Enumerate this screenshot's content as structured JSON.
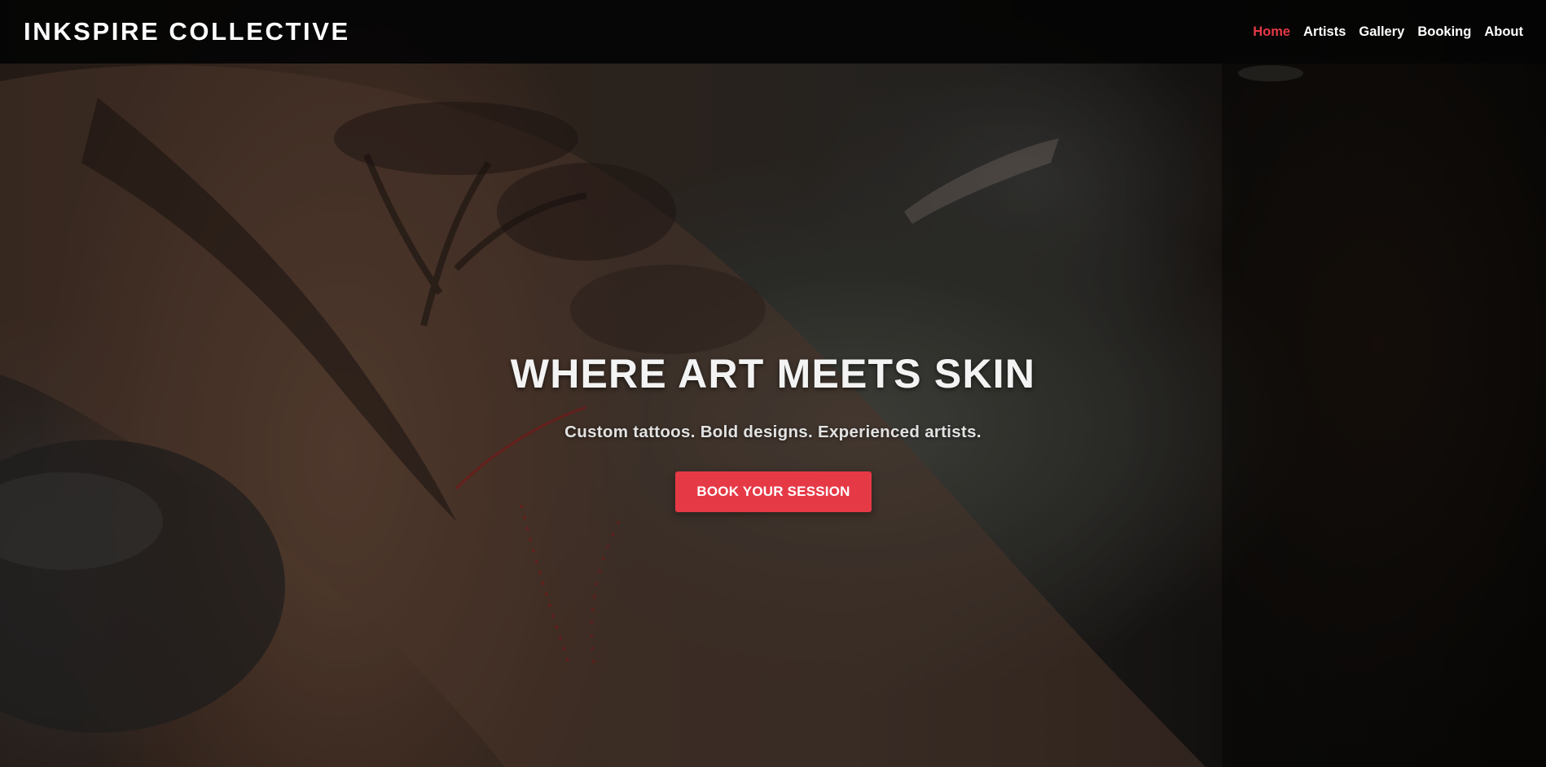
{
  "brand": {
    "name": "INKSPIRE COLLECTIVE"
  },
  "nav": {
    "items": [
      {
        "label": "Home",
        "active": true
      },
      {
        "label": "Artists",
        "active": false
      },
      {
        "label": "Gallery",
        "active": false
      },
      {
        "label": "Booking",
        "active": false
      },
      {
        "label": "About",
        "active": false
      }
    ]
  },
  "hero": {
    "title": "WHERE ART MEETS SKIN",
    "subtitle": "Custom tattoos. Bold designs. Experienced artists.",
    "cta_label": "BOOK YOUR SESSION",
    "background_description_icon": "tattoo-photo-background"
  },
  "colors": {
    "accent": "#e63946",
    "navbar_bg": "#050505",
    "text": "#ffffff"
  }
}
